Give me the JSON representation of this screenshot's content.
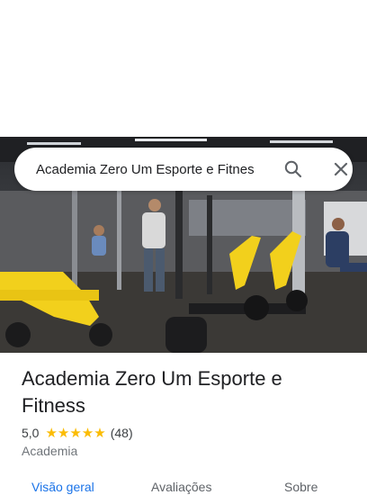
{
  "search": {
    "query": "Academia Zero Um Esporte e Fitnes"
  },
  "place": {
    "name": "Academia Zero Um Esporte e Fitness",
    "rating": "5,0",
    "stars": "★★★★★",
    "reviews_count": "(48)",
    "category": "Academia"
  },
  "tabs": [
    {
      "label": "Visão geral",
      "active": true
    },
    {
      "label": "Avaliações"
    },
    {
      "label": "Sobre"
    }
  ],
  "colors": {
    "accent": "#1a73e8",
    "star": "#fbbc04",
    "equipment": "#f2d01c"
  },
  "icons": {
    "search": "search-icon",
    "close": "close-icon"
  }
}
